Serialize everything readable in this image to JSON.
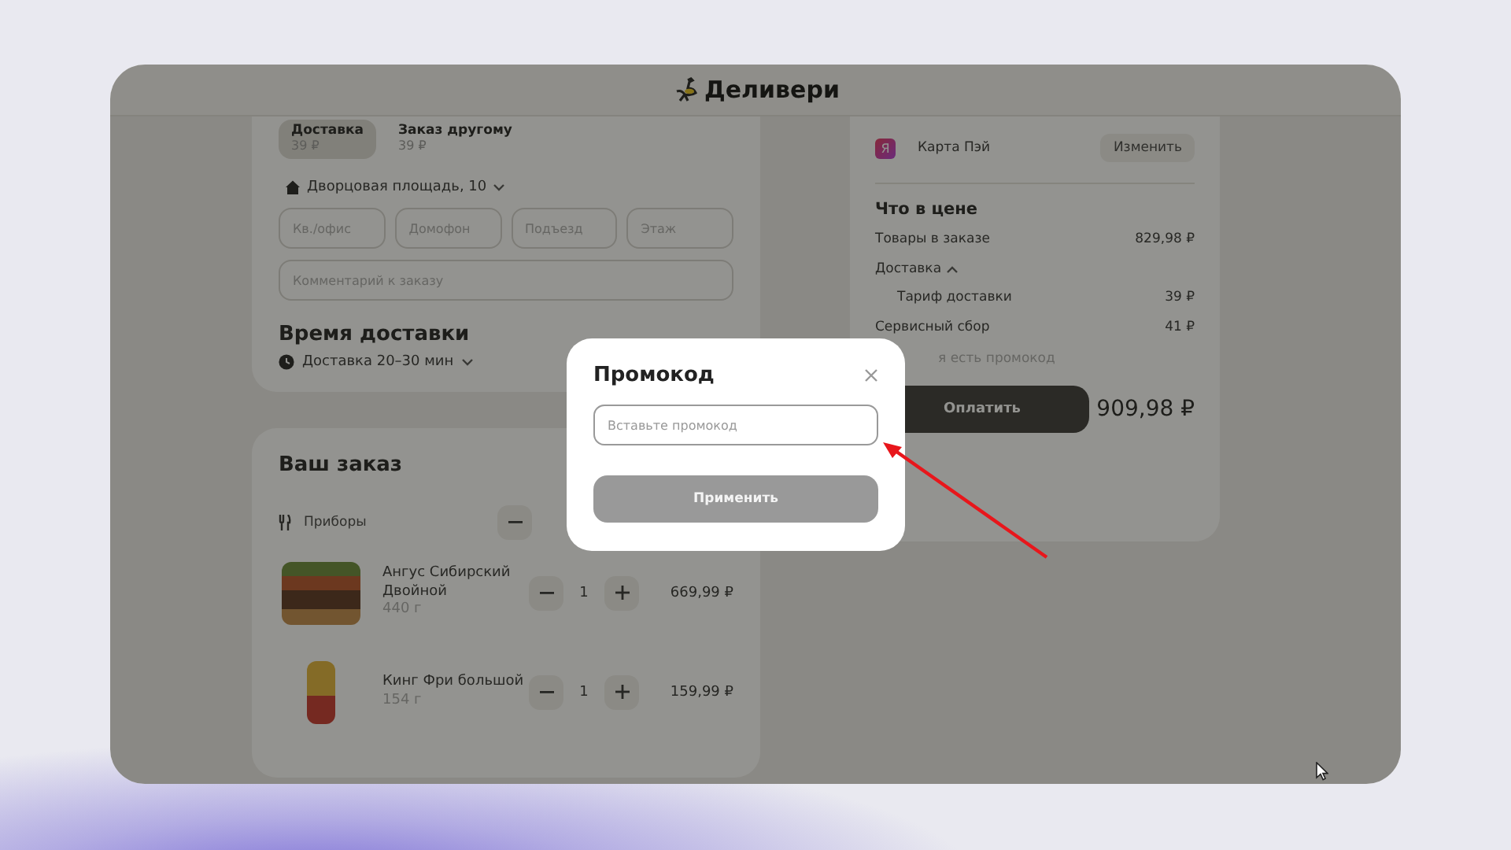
{
  "header": {
    "logo_text": "Деливери"
  },
  "delivery_tabs": [
    {
      "label": "Доставка",
      "price": "39 ₽",
      "selected": true
    },
    {
      "label": "Заказ другому",
      "price": "39 ₽",
      "selected": false
    }
  ],
  "address": "Дворцовая площадь, 10",
  "address_fields": [
    {
      "placeholder": "Кв./офис"
    },
    {
      "placeholder": "Домофон"
    },
    {
      "placeholder": "Подъезд"
    },
    {
      "placeholder": "Этаж"
    }
  ],
  "comment": {
    "placeholder": "Комментарий к заказу"
  },
  "delivery_time": {
    "title": "Время доставки",
    "option": "Доставка 20–30 мин"
  },
  "order": {
    "title": "Ваш заказ",
    "cutlery": {
      "label": "Приборы"
    },
    "items": [
      {
        "name": "Ангус Сибирский Двойной",
        "weight": "440 г",
        "quantity": "1",
        "price": "669,99 ₽"
      },
      {
        "name": "Кинг Фри большой",
        "weight": "154 г",
        "quantity": "1",
        "price": "159,99 ₽"
      }
    ]
  },
  "payment": {
    "icon_letter": "Я",
    "method": "Карта Пэй",
    "change_button": "Изменить"
  },
  "price_breakdown": {
    "title": "Что в цене",
    "rows": [
      {
        "kind": "line",
        "label": "Товары в заказе",
        "value": "829,98 ₽"
      },
      {
        "kind": "group",
        "label": "Доставка",
        "expanded": true,
        "children": [
          {
            "label": "Тариф доставки",
            "value": "39 ₽"
          }
        ]
      },
      {
        "kind": "line",
        "label": "Сервисный сбор",
        "value": "41 ₽"
      }
    ]
  },
  "promo_link": "я есть промокод",
  "pay_button": "Оплатить",
  "total": "909,98 ₽",
  "promo_dialog": {
    "title": "Промокод",
    "input": {
      "placeholder": "Вставьте промокод"
    },
    "apply_button": "Применить",
    "apply_disabled": true
  }
}
